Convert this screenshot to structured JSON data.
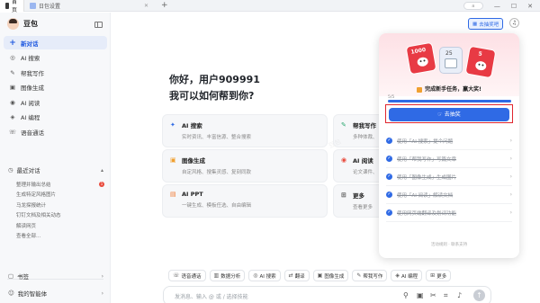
{
  "browser": {
    "tabs": [
      {
        "label": "首页",
        "active": true
      },
      {
        "label": "日包设置",
        "active": false
      }
    ],
    "new_tab": "+",
    "profile_badge": "a",
    "controls": [
      "—",
      "☐",
      "✕"
    ]
  },
  "sidebar": {
    "brand": "豆包",
    "nav": [
      {
        "label": "新对话",
        "icon": "plus-icon",
        "glyph": "+",
        "active": true
      },
      {
        "label": "AI 搜索",
        "icon": "search-icon",
        "glyph": "◎"
      },
      {
        "label": "帮我写作",
        "icon": "pen-icon",
        "glyph": "✎"
      },
      {
        "label": "图像生成",
        "icon": "image-icon",
        "glyph": "▣"
      },
      {
        "label": "AI 阅读",
        "icon": "book-icon",
        "glyph": "◉"
      },
      {
        "label": "AI 编程",
        "icon": "code-icon",
        "glyph": "◈"
      },
      {
        "label": "语音通话",
        "icon": "phone-icon",
        "glyph": "☏"
      }
    ],
    "recent_title": "最近对话",
    "recent": [
      {
        "label": "整理并输出总结",
        "badge": "1"
      },
      {
        "label": "生成特定风格图片"
      },
      {
        "label": "马龙探报统计"
      },
      {
        "label": "钉钉文档及相关动态"
      },
      {
        "label": "解读网页"
      },
      {
        "label": "查看全部..."
      }
    ],
    "bottom": [
      {
        "label": "书签",
        "glyph": "▢"
      },
      {
        "label": "我的智能体",
        "glyph": "☺"
      }
    ]
  },
  "main": {
    "greeting_line1": "你好，用户909991",
    "greeting_line2": "我可以如何帮到你?",
    "cards": [
      {
        "title": "AI 搜索",
        "subtitle": "实时资讯、丰富信源、整合搜索",
        "icon": "search-icon",
        "glyph": "✦",
        "color": "#2f6ae5"
      },
      {
        "title": "帮我写作",
        "subtitle": "多种体裁、",
        "icon": "pen-icon",
        "glyph": "✎",
        "color": "#2aa870"
      },
      {
        "title": "图像生成",
        "subtitle": "自定风格、搜集灵感、复刻同款",
        "icon": "image-icon",
        "glyph": "▣",
        "color": "#f0a030"
      },
      {
        "title": "AI 阅读",
        "subtitle": "论文课件、",
        "icon": "book-icon",
        "glyph": "◉",
        "color": "#e84a3c"
      },
      {
        "title": "AI PPT",
        "subtitle": "一键生成、模板任选、自由编辑",
        "icon": "ppt-icon",
        "glyph": "▤",
        "color": "#f07830"
      },
      {
        "title": "更多",
        "subtitle": "查看更多",
        "icon": "grid-icon",
        "glyph": "⊞",
        "color": "#555555"
      }
    ],
    "toolbar": [
      {
        "label": "语音通话",
        "icon": "phone-icon",
        "glyph": "☏"
      },
      {
        "label": "数据分析",
        "icon": "chart-icon",
        "glyph": "▥"
      },
      {
        "label": "AI 搜索",
        "icon": "search-icon",
        "glyph": "◎"
      },
      {
        "label": "翻译",
        "icon": "translate-icon",
        "glyph": "⇄"
      },
      {
        "label": "图像生成",
        "icon": "image-icon",
        "glyph": "▣"
      },
      {
        "label": "帮我写作",
        "icon": "pen-icon",
        "glyph": "✎"
      },
      {
        "label": "AI 编程",
        "icon": "code-icon",
        "glyph": "◈"
      },
      {
        "label": "更多",
        "icon": "grid-icon",
        "glyph": "⊞"
      }
    ],
    "input_placeholder": "发消息、输入 @ 或 / 选择技能"
  },
  "topbar": {
    "lottery_label": "去抽奖吧",
    "bell_glyph": "♫"
  },
  "popover": {
    "gifts": [
      "1000",
      "25",
      "5"
    ],
    "task_title": "完成新手任务，赢大奖!",
    "progress_label": "5/5",
    "progress_fraction": 1.0,
    "go_button": "去抽奖",
    "tasks": [
      "使用「AI 搜索」提个问题",
      "使用「帮我写作」写篇文章",
      "使用「图像生成」生成图片",
      "使用「AI 阅读」解读文档",
      "使用网页端翻译及划词功能"
    ],
    "footer": "活动规则 · 联系支持"
  },
  "colors": {
    "accent": "#2f6ae5",
    "danger": "#e0262f",
    "sidebar_bg": "#f7f8fa"
  }
}
